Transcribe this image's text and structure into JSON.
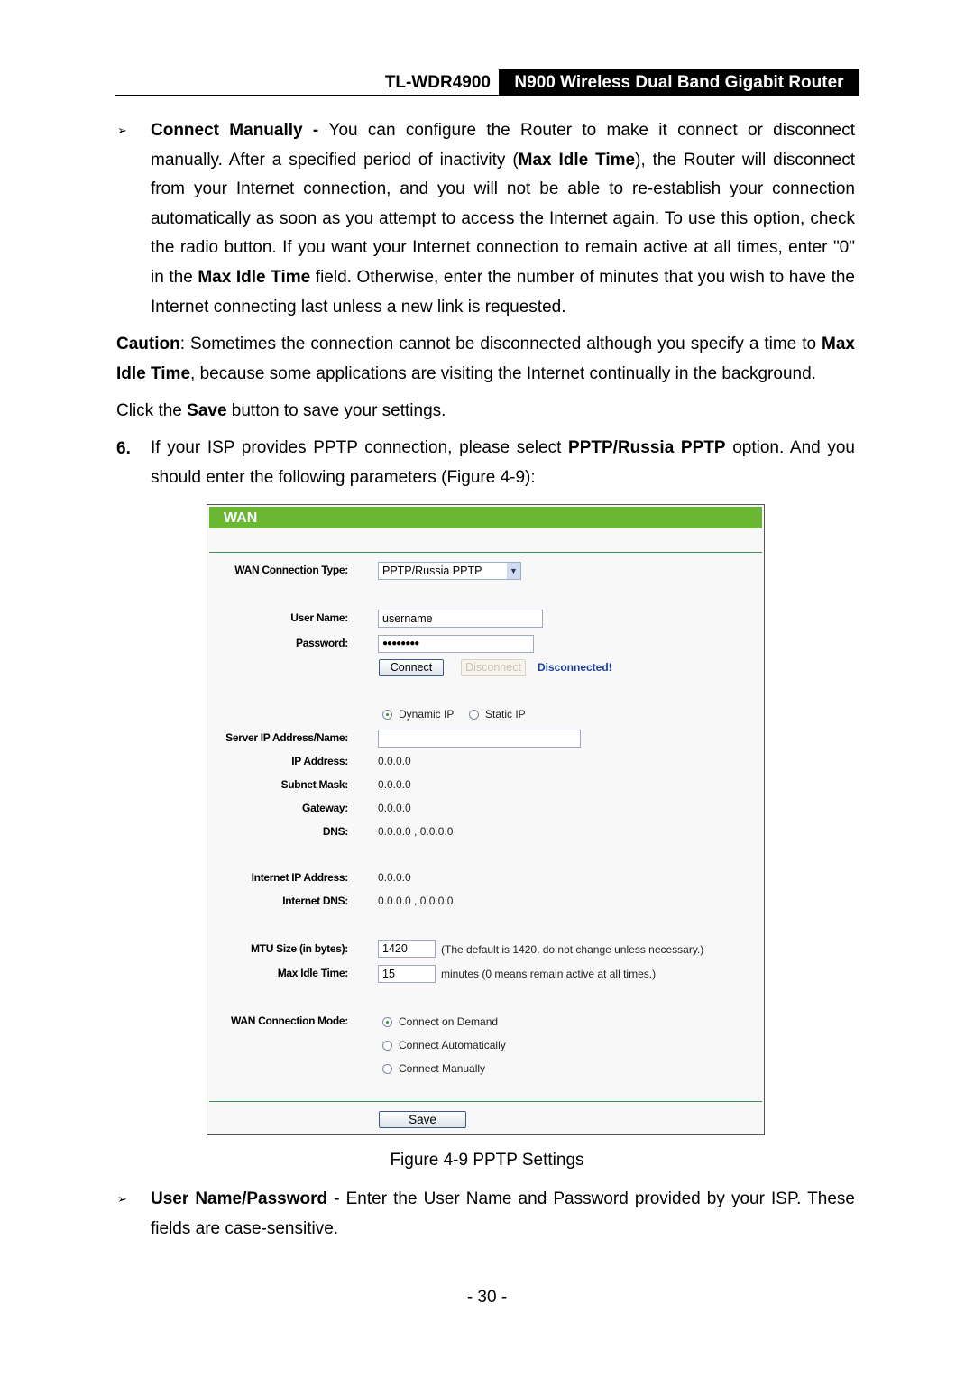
{
  "header": {
    "model": "TL-WDR4900",
    "product": "N900 Wireless Dual Band Gigabit Router"
  },
  "bullet_icon": "arrowhead-bullet",
  "connect_manually": {
    "term": "Connect Manually - ",
    "t1": "You can configure the Router to make it connect or disconnect manually. After a specified period of inactivity (",
    "b1": "Max Idle Time",
    "t2": "), the Router will disconnect from your Internet connection, and you will not be able to re-establish your connection automatically as soon as you attempt to access the Internet again. To use this option, check the radio button. If you want your Internet connection to remain active at all times, enter \"0\" in the ",
    "b2": "Max Idle Time",
    "t3": " field. Otherwise, enter the number of minutes that you wish to have the Internet connecting last unless a new link is requested."
  },
  "caution": {
    "term": "Caution",
    "t1": ": Sometimes the connection cannot be disconnected although you specify a time to ",
    "b1": "Max Idle Time",
    "t2": ", because some applications are visiting the Internet continually in the background."
  },
  "save_note": {
    "t1": "Click the ",
    "b1": "Save",
    "t2": " button to save your settings."
  },
  "step6": {
    "num": "6.",
    "t1": "If your ISP provides PPTP connection, please select ",
    "b1": "PPTP/Russia PPTP",
    "t2": " option. And you should enter the following parameters (Figure 4-9):"
  },
  "figure": {
    "title": "WAN",
    "accent": "#6ab832",
    "wan_type_label": "WAN Connection Type:",
    "wan_type_value": "PPTP/Russia PPTP",
    "user_label": "User Name:",
    "user_value": "username",
    "pass_label": "Password:",
    "pass_value": "●●●●●●●●",
    "connect": "Connect",
    "disconnect": "Disconnect",
    "status": "Disconnected!",
    "dynamic_ip": "Dynamic IP",
    "static_ip": "Static IP",
    "server_label": "Server IP Address/Name:",
    "server_value": "",
    "ip_label": "IP Address:",
    "ip_value": "0.0.0.0",
    "mask_label": "Subnet Mask:",
    "mask_value": "0.0.0.0",
    "gw_label": "Gateway:",
    "gw_value": "0.0.0.0",
    "dns_label": "DNS:",
    "dns_value": "0.0.0.0 , 0.0.0.0",
    "inet_ip_label": "Internet IP Address:",
    "inet_ip_value": "0.0.0.0",
    "inet_dns_label": "Internet DNS:",
    "inet_dns_value": "0.0.0.0 , 0.0.0.0",
    "mtu_label": "MTU Size (in bytes):",
    "mtu_value": "1420",
    "mtu_note": "(The default is 1420, do not change unless necessary.)",
    "idle_label": "Max Idle Time:",
    "idle_value": "15",
    "idle_note": "minutes (0 means remain active at all times.)",
    "mode_label": "WAN Connection Mode:",
    "modes": [
      "Connect on Demand",
      "Connect Automatically",
      "Connect Manually"
    ],
    "save": "Save"
  },
  "caption": "Figure 4-9 PPTP Settings",
  "user_pass": {
    "term": "User Name/Password",
    "t1": " - Enter the User Name and Password provided by your ISP. These fields are case-sensitive."
  },
  "page_number": "- 30 -"
}
